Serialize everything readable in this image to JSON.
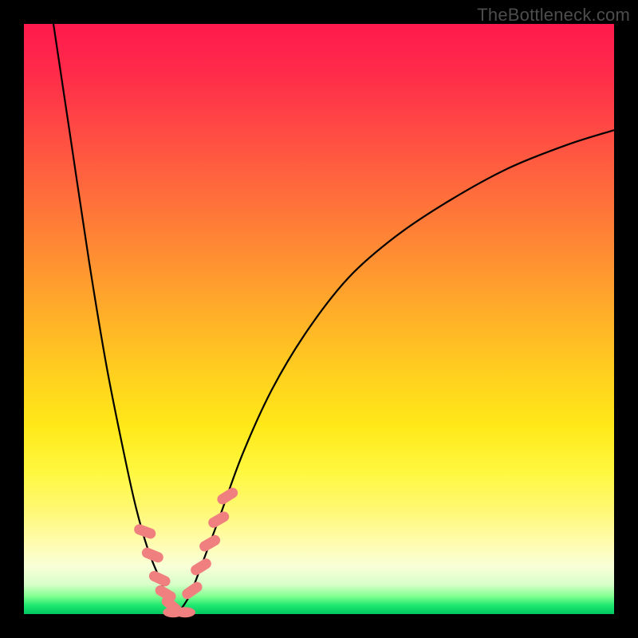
{
  "watermark": "TheBottleneck.com",
  "colors": {
    "frame": "#000000",
    "curve": "#000000",
    "marker_fill": "#f08080",
    "marker_stroke": "#e06868"
  },
  "chart_data": {
    "type": "line",
    "title": "",
    "xlabel": "",
    "ylabel": "",
    "xlim": [
      0,
      100
    ],
    "ylim": [
      0,
      100
    ],
    "grid": false,
    "legend": false,
    "series": [
      {
        "name": "left-branch",
        "x": [
          5,
          8,
          11,
          14,
          17,
          19,
          21,
          23,
          24.5,
          26
        ],
        "y": [
          100,
          80,
          60,
          42,
          27,
          18,
          11,
          6,
          2.5,
          0
        ]
      },
      {
        "name": "right-branch",
        "x": [
          26,
          28,
          30,
          33,
          37,
          42,
          48,
          55,
          63,
          72,
          82,
          92,
          100
        ],
        "y": [
          0,
          3,
          8,
          16,
          27,
          38,
          48,
          57,
          64,
          70,
          75.5,
          79.5,
          82
        ]
      }
    ],
    "markers_left": [
      {
        "x": 20.5,
        "y": 14,
        "rot": -70
      },
      {
        "x": 21.8,
        "y": 10,
        "rot": -68
      },
      {
        "x": 23.0,
        "y": 6,
        "rot": -65
      },
      {
        "x": 24.0,
        "y": 3.5,
        "rot": -60
      },
      {
        "x": 25.0,
        "y": 1.5,
        "rot": -50
      }
    ],
    "markers_right": [
      {
        "x": 28.5,
        "y": 4,
        "rot": 55
      },
      {
        "x": 30.0,
        "y": 8,
        "rot": 58
      },
      {
        "x": 31.5,
        "y": 12,
        "rot": 60
      },
      {
        "x": 33.0,
        "y": 16,
        "rot": 60
      },
      {
        "x": 34.5,
        "y": 20,
        "rot": 58
      }
    ],
    "markers_bottom": [
      {
        "x": 25.3,
        "y": 0.3,
        "rot": 0
      },
      {
        "x": 27.3,
        "y": 0.3,
        "rot": 0
      }
    ]
  }
}
